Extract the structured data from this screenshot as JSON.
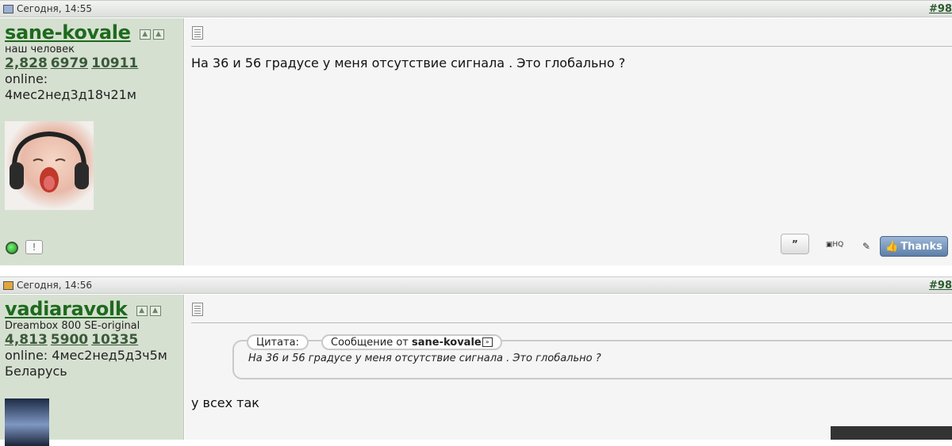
{
  "posts": [
    {
      "date": "Сегодня, 14:55",
      "post_num": "#98",
      "username": "sane-kovale",
      "user_title": "наш человек",
      "stats": [
        "2,828",
        "6979",
        "10911"
      ],
      "online_label": "online:",
      "online_time": "4мес2нед3д18ч21м",
      "message": "На 36 и 56 градусе у меня отсутствие сигнала . Это глобально ?",
      "buttons": [
        "Thanks"
      ]
    },
    {
      "date": "Сегодня, 14:56",
      "post_num": "#98",
      "username": "vadiaravolk",
      "user_title": "Dreambox 800 SE-original",
      "stats": [
        "4,813",
        "5900",
        "10335"
      ],
      "online_line": "online: 4мес2нед5д3ч5м",
      "location": "Беларусь",
      "quote_label": "Цитата:",
      "quote_from_prefix": "Сообщение от",
      "quote_author": "sane-kovale",
      "quote_text": "На 36 и 56 градусе у меня отсутствие сигнала . Это глобально ?",
      "message": "у всех так"
    }
  ]
}
